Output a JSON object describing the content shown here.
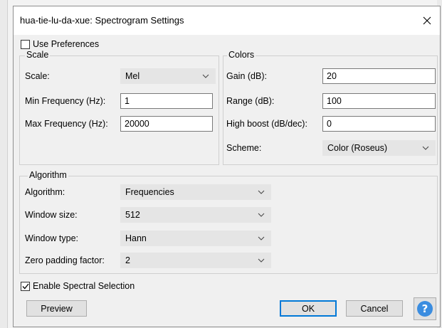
{
  "window": {
    "title": "hua-tie-lu-da-xue: Spectrogram Settings",
    "close_icon": "close-icon"
  },
  "use_preferences": {
    "label": "Use Preferences",
    "checked": false
  },
  "scale_group": {
    "title": "Scale",
    "scale_label": "Scale:",
    "scale_value": "Mel",
    "min_freq_label": "Min Frequency (Hz):",
    "min_freq_value": "1",
    "max_freq_label": "Max Frequency (Hz):",
    "max_freq_value": "20000"
  },
  "colors_group": {
    "title": "Colors",
    "gain_label": "Gain (dB):",
    "gain_value": "20",
    "range_label": "Range (dB):",
    "range_value": "100",
    "high_boost_label": "High boost (dB/dec):",
    "high_boost_value": "0",
    "scheme_label": "Scheme:",
    "scheme_value": "Color (Roseus)"
  },
  "algorithm_group": {
    "title": "Algorithm",
    "algorithm_label": "Algorithm:",
    "algorithm_value": "Frequencies",
    "window_size_label": "Window size:",
    "window_size_value": "512",
    "window_type_label": "Window type:",
    "window_type_value": "Hann",
    "zero_padding_label": "Zero padding factor:",
    "zero_padding_value": "2"
  },
  "spectral_selection": {
    "label": "Enable Spectral Selection",
    "checked": true
  },
  "buttons": {
    "preview": "Preview",
    "ok": "OK",
    "cancel": "Cancel",
    "help": "?"
  },
  "colors": {
    "accent": "#0078d7",
    "help_icon": "#3b8de0"
  }
}
